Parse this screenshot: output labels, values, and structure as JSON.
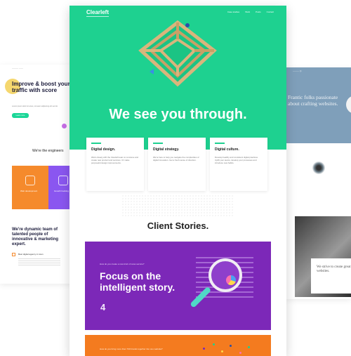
{
  "left_page": {
    "nav_label": "——— ——",
    "hero_title": "Improve & boost your traffic with score",
    "hero_sub": "Lorem ipsum dolor sit amet, consetur adipiscing elit sed do.",
    "cta_label": "Learn more",
    "section_title": "We're the engineers",
    "tile_1_text": "Web development",
    "tile_2_text": "Growth hacking",
    "team_title": "We're dynamic team of talented people of innovative & marketing expert.",
    "check_text": "Best digital agency in town",
    "signature": "Signature"
  },
  "right_page": {
    "logo": "——— ◎",
    "hero_title": "Frantic folks passionate about crafting websites.",
    "card_text": "We strive to create great websites."
  },
  "main_page": {
    "brand": "Clearleft",
    "nav": [
      "Case studies",
      "Work",
      "Posts",
      "Contact"
    ],
    "headline": "We see you through.",
    "cards": [
      {
        "title": "Digital design.",
        "body": "Work closely with the Clearleft team to conceive and create new product and services. Or make purposeful design improvements."
      },
      {
        "title": "Digital strategy.",
        "body": "We're here to help you navigate the complexities of digital innovation. Get a fresh sense of direction."
      },
      {
        "title": "Digital culture.",
        "body": "Develop healthy and consistent digital practices. Uplift your teams, develop your processes and introduce new habits."
      }
    ],
    "stories_title": "Client Stories.",
    "story_1": {
      "question": "How do you create a new kind of news service?",
      "title": "Focus on the intelligent story.",
      "logo": "4"
    },
    "story_2": {
      "question": "How do you bring more than 700 brands together into one website?"
    }
  },
  "colors": {
    "green": "#1ed190",
    "purple": "#7c28b8",
    "orange": "#f47b1f"
  }
}
